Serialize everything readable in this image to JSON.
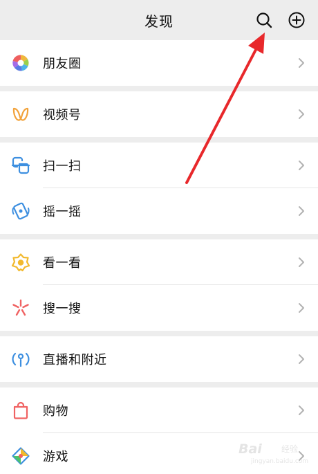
{
  "header": {
    "title": "发现",
    "search_icon": "search-icon",
    "add_icon": "plus-circle-icon"
  },
  "sections": [
    {
      "items": [
        {
          "label": "朋友圈",
          "icon": "moments-aperture-icon"
        }
      ]
    },
    {
      "items": [
        {
          "label": "视频号",
          "icon": "channels-butterfly-icon"
        }
      ]
    },
    {
      "items": [
        {
          "label": "扫一扫",
          "icon": "scan-icon"
        },
        {
          "label": "摇一摇",
          "icon": "shake-icon"
        }
      ]
    },
    {
      "items": [
        {
          "label": "看一看",
          "icon": "top-stories-icon"
        },
        {
          "label": "搜一搜",
          "icon": "search-sparkle-icon"
        }
      ]
    },
    {
      "items": [
        {
          "label": "直播和附近",
          "icon": "live-nearby-icon"
        }
      ]
    },
    {
      "items": [
        {
          "label": "购物",
          "icon": "shopping-bag-icon"
        },
        {
          "label": "游戏",
          "icon": "games-icon"
        }
      ]
    }
  ],
  "colors": {
    "background": "#ededed",
    "row_background": "#ffffff",
    "annotation_arrow": "#e8282b",
    "chevron": "#b2b2b2"
  },
  "watermark": {
    "main": "Bai",
    "sub": "经验",
    "url": "jingyan.baidu.com"
  }
}
